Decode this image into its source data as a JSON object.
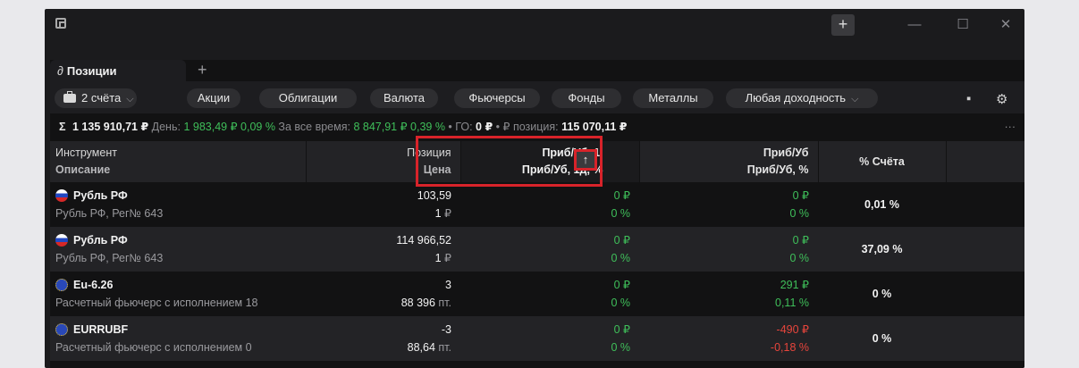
{
  "titlebar": {
    "add_label": "+",
    "min_label": "—",
    "max_label": "☐",
    "close_label": "✕"
  },
  "tab": {
    "label": "Позиции",
    "add_label": "+"
  },
  "toolbar": {
    "accounts_label": "2 счёта",
    "filters": [
      "Акции",
      "Облигации",
      "Валюта",
      "Фьючерсы",
      "Фонды",
      "Металлы"
    ],
    "yield_filter": "Любая доходность"
  },
  "summary": {
    "total": "1 135 910,71 ₽",
    "day_label": "День:",
    "day_value": "1 983,49 ₽",
    "day_pct": "0,09 %",
    "all_time_label": "За все время:",
    "all_time_value": "8 847,91 ₽",
    "all_time_pct": "0,39 %",
    "go_label": "ГО:",
    "go_value": "0 ₽",
    "rub_label": "₽ позиция:",
    "rub_value": "115 070,11 ₽",
    "more_label": "···"
  },
  "columns": {
    "instrument": {
      "l1": "Инструмент",
      "l2": "Описание"
    },
    "position": {
      "l1": "Позиция",
      "l2": "Цена"
    },
    "pnl_day": {
      "l1": "Приб/Уб, 1,",
      "l2": "Приб/Уб, 1д, %"
    },
    "pnl": {
      "l1": "Приб/Уб",
      "l2": "Приб/Уб, %"
    },
    "account_pct": {
      "l1": "% Счёта"
    }
  },
  "rows": [
    {
      "flag": "ru",
      "name": "Рубль РФ",
      "desc": "Рубль РФ, Рег№ 643",
      "qty": "103,59",
      "price": "1",
      "price_unit": "₽",
      "day_abs": "0 ₽",
      "day_pct": "0 %",
      "pnl_abs": "0 ₽",
      "pnl_pct": "0 %",
      "pnl_color": "green",
      "account_pct": "0,01 %"
    },
    {
      "flag": "ru",
      "name": "Рубль РФ",
      "desc": "Рубль РФ, Рег№ 643",
      "qty": "114 966,52",
      "price": "1",
      "price_unit": "₽",
      "day_abs": "0 ₽",
      "day_pct": "0 %",
      "pnl_abs": "0 ₽",
      "pnl_pct": "0 %",
      "pnl_color": "green",
      "account_pct": "37,09 %"
    },
    {
      "flag": "eu",
      "name": "Eu-6.26",
      "desc": "Расчетный фьючерс с исполнением 18",
      "qty": "3",
      "price": "88 396",
      "price_unit": "пт.",
      "day_abs": "0 ₽",
      "day_pct": "0 %",
      "pnl_abs": "291 ₽",
      "pnl_pct": "0,11 %",
      "pnl_color": "green",
      "account_pct": "0 %"
    },
    {
      "flag": "eu",
      "name": "EURRUBF",
      "desc": "Расчетный фьючерс с исполнением 0",
      "qty": "-3",
      "price": "88,64",
      "price_unit": "пт.",
      "day_abs": "0 ₽",
      "day_pct": "0 %",
      "pnl_abs": "-490 ₽",
      "pnl_pct": "-0,18 %",
      "pnl_color": "red",
      "account_pct": "0 %"
    }
  ],
  "sort_button": {
    "icon": "arrow-up-icon",
    "label": "↑"
  },
  "colors": {
    "green": "#3fbf5a",
    "red": "#e8453c",
    "highlight": "#d8232a"
  }
}
